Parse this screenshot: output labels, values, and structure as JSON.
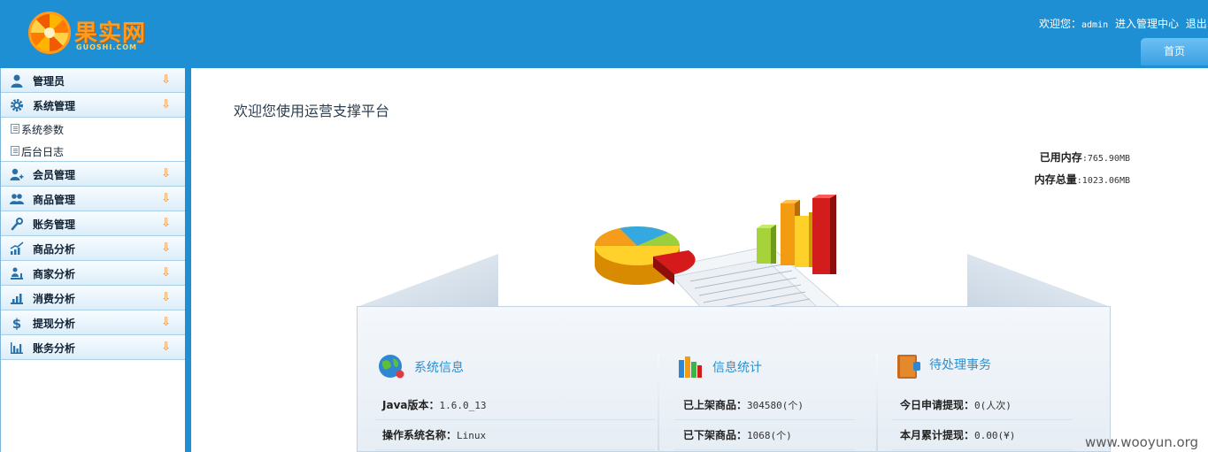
{
  "header": {
    "logo_text": "果实网",
    "logo_sub": "GUOSHI.COM",
    "welcome_prefix": "欢迎您：",
    "username": "admin",
    "enter_admin": "进入管理中心",
    "logout": "退出系",
    "home_tab": "首页"
  },
  "sidebar": {
    "menus": [
      {
        "label": "管理员",
        "icon": "user-icon"
      },
      {
        "label": "系统管理",
        "icon": "gear-icon"
      },
      {
        "label": "会员管理",
        "icon": "user-add-icon"
      },
      {
        "label": "商品管理",
        "icon": "users-icon"
      },
      {
        "label": "账务管理",
        "icon": "wrench-icon"
      },
      {
        "label": "商品分析",
        "icon": "chart-rise-icon"
      },
      {
        "label": "商家分析",
        "icon": "chart-person-icon"
      },
      {
        "label": "消费分析",
        "icon": "chart-coin-icon"
      },
      {
        "label": "提现分析",
        "icon": "dollar-icon"
      },
      {
        "label": "账务分析",
        "icon": "bar-chart-icon"
      }
    ],
    "submenu": [
      {
        "label": "系统参数"
      },
      {
        "label": "后台日志"
      }
    ],
    "arrow": "⇩"
  },
  "main": {
    "welcome": "欢迎您使用运营支撑平台",
    "memory": {
      "used_label": "已用内存",
      "used_value": ":765.90MB",
      "total_label": "内存总量",
      "total_value": ":1023.06MB"
    }
  },
  "panel": {
    "system": {
      "title": "系统信息",
      "rows": [
        {
          "key": "Java版本：",
          "value": "1.6.0_13"
        },
        {
          "key": "操作系统名称：",
          "value": "Linux"
        }
      ]
    },
    "stats": {
      "title": "信息统计",
      "rows": [
        {
          "key": "已上架商品：",
          "value": "304580(个)"
        },
        {
          "key": "已下架商品：",
          "value": "1068(个)"
        }
      ]
    },
    "todo": {
      "title": "待处理事务",
      "rows": [
        {
          "key": "今日申请提现：",
          "value": "0(人次)"
        },
        {
          "key": "本月累计提现：",
          "value": "0.00(¥)"
        }
      ]
    }
  },
  "watermark": "www.wooyun.org",
  "colors": {
    "header_blue": "#1f8fd3",
    "accent_orange": "#ff8a1a",
    "title_blue": "#2a8fd0"
  }
}
